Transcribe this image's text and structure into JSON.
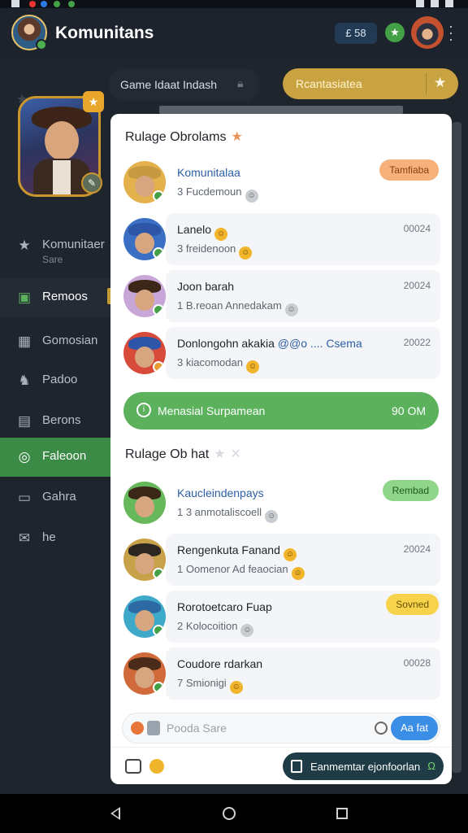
{
  "app": {
    "title": "Komunitans",
    "count_pill": "£ 58",
    "star": "★"
  },
  "status": {
    "dots": [
      "#e33",
      "#2c7be5",
      "#43a047",
      "#43a047"
    ]
  },
  "sidebar": {
    "items": [
      {
        "label": "Komunitaer",
        "sub": "Sare",
        "icon": "★"
      },
      {
        "label": "Remoos",
        "icon": "▣"
      },
      {
        "label": "Gomosian",
        "icon": "▦"
      },
      {
        "label": "Padoo",
        "icon": "♞"
      },
      {
        "label": "Berons",
        "icon": "▤"
      },
      {
        "label": "Faleoon",
        "icon": "◎"
      },
      {
        "label": "Gahra",
        "icon": "▭"
      },
      {
        "label": "he",
        "icon": "✉"
      }
    ]
  },
  "gamebar": {
    "left": "Game Idaat Indash",
    "right": "Rcantasiatea",
    "right_icon": "★"
  },
  "panel": {
    "section1_title": "Rulage Obrolams",
    "section1_star": "★",
    "section2_title": "Rulage Ob hat",
    "section2_icons": [
      "★",
      "✕"
    ],
    "chats1": [
      {
        "name": "Komunitalaa",
        "sub": "3 Fucdemoun",
        "time": "",
        "tag": "Tamfiaba",
        "tag_color": "orange",
        "hat": "#c79a42",
        "bg": "#e3b24d",
        "mark": "#43a047"
      },
      {
        "name": "Lanelo",
        "sub": "3 freidenoon",
        "time": "00024",
        "tag": "",
        "hat": "#2d56a8",
        "bg": "#3a6fc4",
        "mark": "#43a047"
      },
      {
        "name": "Joon barah",
        "sub": "1 B.reoan Annedakam",
        "time": "20024",
        "tag": "",
        "hat": "#3a2718",
        "bg": "#c9a6d8",
        "mark": "#43a047"
      },
      {
        "name": "Donlongohn akakia",
        "extra": "@@o .... Csema",
        "sub": "3 kiacomodan",
        "time": "20022",
        "tag": "",
        "hat": "#2d56a8",
        "bg": "#d84a3a",
        "mark": "#e89a35"
      }
    ],
    "banner": {
      "text": "Menasial Surpamean",
      "right": "90 OM"
    },
    "chats2": [
      {
        "name": "Kaucleindenpays",
        "sub": "1 3 anmotaliscoell",
        "time": "",
        "tag": "Rembad",
        "tag_color": "green",
        "hat": "#3a2718",
        "bg": "#67b85a",
        "mark": ""
      },
      {
        "name": "Rengenkuta Fanand",
        "sub": "1 Oomenor Ad feaocian",
        "time": "20024",
        "tag": "",
        "hat": "#2b2622",
        "bg": "#c8a24a",
        "mark": "#43a047"
      },
      {
        "name": "Rorotoetcaro Fuap",
        "sub": "2 Kolocoition",
        "time": "",
        "tag": "Sovned",
        "tag_color": "yellow",
        "hat": "#2d6aa3",
        "bg": "#3fa9c9",
        "mark": "#43a047"
      },
      {
        "name": "Coudore rdarkan",
        "sub": "7 Smionigi",
        "time": "00028",
        "tag": "",
        "hat": "#4a2a18",
        "bg": "#d06a3a",
        "mark": "#43a047"
      }
    ],
    "composer": {
      "placeholder": "Pooda Sare",
      "send": "Aa fat"
    },
    "footer": {
      "button": "Eanmemtar ejonfoorlan",
      "icon": "Ω"
    }
  }
}
